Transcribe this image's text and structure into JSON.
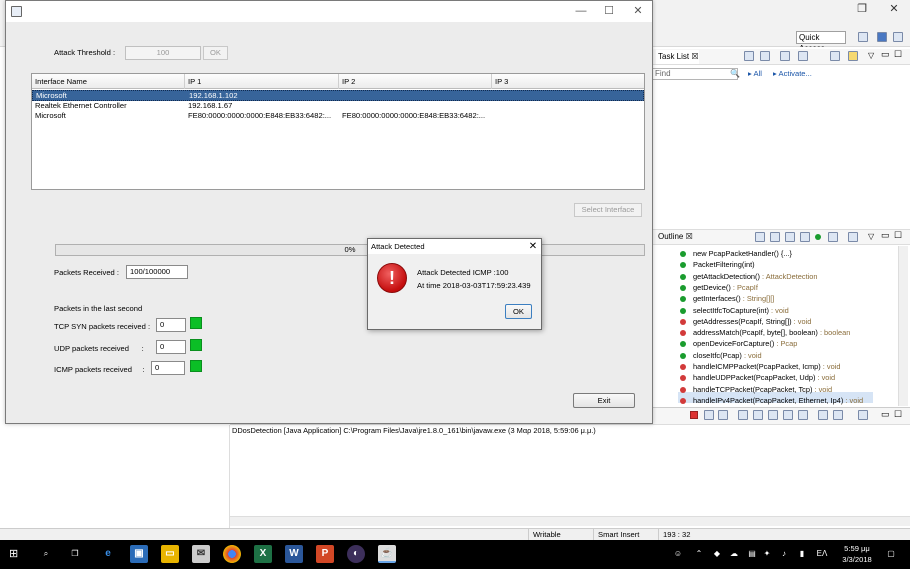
{
  "eclipse": {
    "quick_access": "Quick Access",
    "task_list_tab": "Task List",
    "find_placeholder": "Find",
    "all_label": "All",
    "activate_label": "Activate...",
    "outline_tab": "Outline",
    "outline_items": [
      {
        "name": "new PcapPacketHandler() {...}",
        "type": "",
        "dot": "#1a9c2e"
      },
      {
        "name": "PacketFiltering(int)",
        "type": "",
        "dot": "#1a9c2e"
      },
      {
        "name": "getAttackDetection()",
        "type": " : AttackDetection",
        "dot": "#1a9c2e"
      },
      {
        "name": "getDevice()",
        "type": " : PcapIf",
        "dot": "#1a9c2e"
      },
      {
        "name": "getInterfaces()",
        "type": " : String[][]",
        "dot": "#1a9c2e"
      },
      {
        "name": "selectItfcToCapture(int)",
        "type": " : void",
        "dot": "#1a9c2e"
      },
      {
        "name": "getAddresses(PcapIf, String[])",
        "type": " : void",
        "dot": "#d23a3a"
      },
      {
        "name": "addressMatch(PcapIf, byte[], boolean)",
        "type": " : boolean",
        "dot": "#d23a3a"
      },
      {
        "name": "openDeviceForCapture()",
        "type": " : Pcap",
        "dot": "#1a9c2e"
      },
      {
        "name": "closeItfc(Pcap)",
        "type": " : void",
        "dot": "#1a9c2e"
      },
      {
        "name": "handleICMPPacket(PcapPacket, Icmp)",
        "type": " : void",
        "dot": "#d23a3a"
      },
      {
        "name": "handleUDPPacket(PcapPacket, Udp)",
        "type": " : void",
        "dot": "#d23a3a"
      },
      {
        "name": "handleTCPPacket(PcapPacket, Tcp)",
        "type": " : void",
        "dot": "#d23a3a"
      },
      {
        "name": "handleIPv4Packet(PcapPacket, Ethernet, Ip4)",
        "type": " : void",
        "dot": "#d23a3a"
      }
    ],
    "console_title": "DDosDetection [Java Application] C:\\Program Files\\Java\\jre1.8.0_161\\bin\\javaw.exe (3 Μαρ 2018, 5:59:06 μ.μ.)",
    "status": {
      "writable": "Writable",
      "insert": "Smart Insert",
      "position": "193 : 32"
    }
  },
  "main": {
    "window_buttons": {
      "minimize": "—",
      "maximize": "☐",
      "close": "✕"
    },
    "threshold_label": "Attack Threshold :",
    "threshold_value": "100",
    "ok_label": "OK",
    "table": {
      "columns": [
        "Interface Name",
        "IP 1",
        "IP 2",
        "IP 3"
      ],
      "rows": [
        [
          "Microsoft",
          "192.168.1.102",
          "",
          ""
        ],
        [
          "Realtek Ethernet Controller",
          "192.168.1.67",
          "",
          ""
        ],
        [
          "Microsoft",
          "FE80:0000:0000:0000:E848:EB33:6482:...",
          "FE80:0000:0000:0000:E848:EB33:6482:...",
          ""
        ]
      ]
    },
    "select_interface_label": "Select Interface",
    "progress_text": "0%",
    "progress_value": 0,
    "packets_received_label": "Packets Received :",
    "packets_received_value": "100/100000",
    "last_second_label": "Packets in the last second",
    "tcp_label": "TCP SYN packets received :",
    "tcp_value": "0",
    "udp_label": "UDP packets received      :",
    "udp_value": "0",
    "icmp_label": "ICMP packets received     :",
    "icmp_value": "0",
    "exit_label": "Exit"
  },
  "dialog": {
    "title": "Attack Detected",
    "close": "✕",
    "message_line1": "Attack Detected ICMP :100",
    "message_line2": "At time 2018-03-03T17:59:23.439",
    "ok_label": "OK",
    "icon_glyph": "!"
  },
  "taskbar": {
    "time": "5:59 μμ",
    "date": "3/3/2018",
    "lang": "ΕΛ"
  },
  "colors": {
    "selection": "#37649a",
    "indicator_green": "#0bbf26",
    "error_red": "#c40d0d"
  }
}
